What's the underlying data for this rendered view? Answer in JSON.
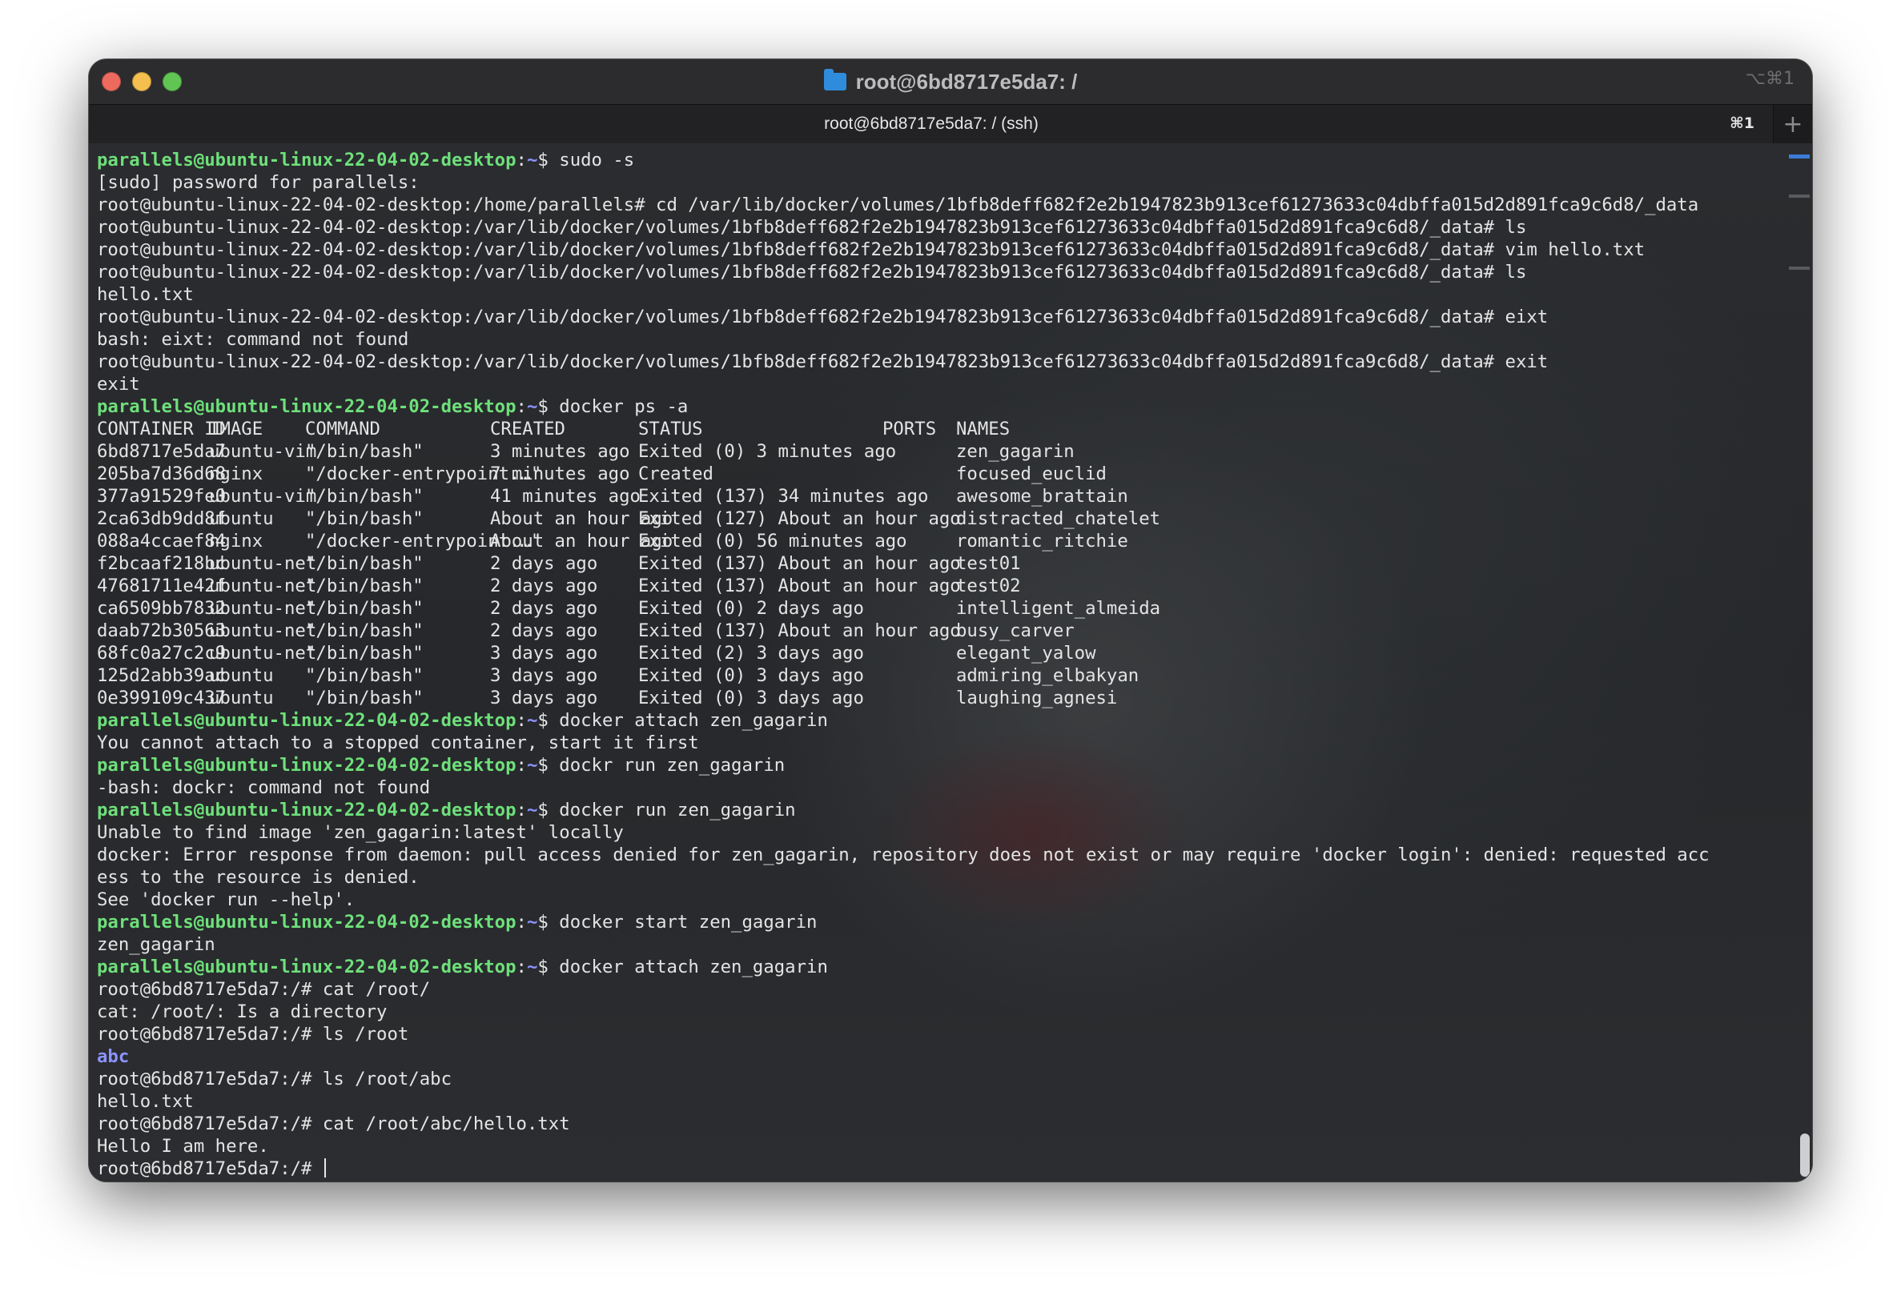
{
  "window": {
    "title": "root@6bd8717e5da7: /",
    "shortcut": "⌥⌘1",
    "tab_label": "root@6bd8717e5da7: / (ssh)",
    "tab_shortcut": "⌘1",
    "new_tab": "+"
  },
  "colors": {
    "prompt_green": "#6ee07a",
    "dir_blue": "#8d93ff",
    "text": "#e4e4e4",
    "close": "#ed6a5e",
    "minimize": "#f4bf4f",
    "zoom": "#61c554"
  },
  "terminal": {
    "prompt_user": "parallels@ubuntu-linux-22-04-02-desktop",
    "lines_a": [
      {
        "type": "prompt",
        "path": "~",
        "cmd": " sudo -s"
      },
      {
        "type": "text",
        "text": "[sudo] password for parallels:"
      },
      {
        "type": "text",
        "text": "root@ubuntu-linux-22-04-02-desktop:/home/parallels# cd /var/lib/docker/volumes/1bfb8deff682f2e2b1947823b913cef61273633c04dbffa015d2d891fca9c6d8/_data"
      },
      {
        "type": "text",
        "text": "root@ubuntu-linux-22-04-02-desktop:/var/lib/docker/volumes/1bfb8deff682f2e2b1947823b913cef61273633c04dbffa015d2d891fca9c6d8/_data# ls"
      },
      {
        "type": "text",
        "text": "root@ubuntu-linux-22-04-02-desktop:/var/lib/docker/volumes/1bfb8deff682f2e2b1947823b913cef61273633c04dbffa015d2d891fca9c6d8/_data# vim hello.txt"
      },
      {
        "type": "text",
        "text": "root@ubuntu-linux-22-04-02-desktop:/var/lib/docker/volumes/1bfb8deff682f2e2b1947823b913cef61273633c04dbffa015d2d891fca9c6d8/_data# ls"
      },
      {
        "type": "text",
        "text": "hello.txt"
      },
      {
        "type": "text",
        "text": "root@ubuntu-linux-22-04-02-desktop:/var/lib/docker/volumes/1bfb8deff682f2e2b1947823b913cef61273633c04dbffa015d2d891fca9c6d8/_data# eixt"
      },
      {
        "type": "text",
        "text": "bash: eixt: command not found"
      },
      {
        "type": "text",
        "text": "root@ubuntu-linux-22-04-02-desktop:/var/lib/docker/volumes/1bfb8deff682f2e2b1947823b913cef61273633c04dbffa015d2d891fca9c6d8/_data# exit"
      },
      {
        "type": "text",
        "text": "exit"
      },
      {
        "type": "prompt",
        "path": "~",
        "cmd": " docker ps -a"
      }
    ],
    "ps_table": {
      "headers": [
        "CONTAINER ID",
        "IMAGE",
        "COMMAND",
        "CREATED",
        "STATUS",
        "PORTS",
        "NAMES"
      ],
      "rows": [
        [
          "6bd8717e5da7",
          "ubuntu-vim",
          "\"/bin/bash\"",
          "3 minutes ago",
          "Exited (0) 3 minutes ago",
          "",
          "zen_gagarin"
        ],
        [
          "205ba7d36d68",
          "nginx",
          "\"/docker-entrypoint.…\"",
          "7 minutes ago",
          "Created",
          "",
          "focused_euclid"
        ],
        [
          "377a91529fe0",
          "ubuntu-vim",
          "\"/bin/bash\"",
          "41 minutes ago",
          "Exited (137) 34 minutes ago",
          "",
          "awesome_brattain"
        ],
        [
          "2ca63db9dd8f",
          "ubuntu",
          "\"/bin/bash\"",
          "About an hour ago",
          "Exited (127) About an hour ago",
          "",
          "distracted_chatelet"
        ],
        [
          "088a4ccaef84",
          "nginx",
          "\"/docker-entrypoint.…\"",
          "About an hour ago",
          "Exited (0) 56 minutes ago",
          "",
          "romantic_ritchie"
        ],
        [
          "f2bcaaf218bc",
          "ubuntu-net",
          "\"/bin/bash\"",
          "2 days ago",
          "Exited (137) About an hour ago",
          "",
          "test01"
        ],
        [
          "47681711e42f",
          "ubuntu-net",
          "\"/bin/bash\"",
          "2 days ago",
          "Exited (137) About an hour ago",
          "",
          "test02"
        ],
        [
          "ca6509bb7832",
          "ubuntu-net",
          "\"/bin/bash\"",
          "2 days ago",
          "Exited (0) 2 days ago",
          "",
          "intelligent_almeida"
        ],
        [
          "daab72b30563",
          "ubuntu-net",
          "\"/bin/bash\"",
          "2 days ago",
          "Exited (137) About an hour ago",
          "",
          "busy_carver"
        ],
        [
          "68fc0a27c2c9",
          "ubuntu-net",
          "\"/bin/bash\"",
          "3 days ago",
          "Exited (2) 3 days ago",
          "",
          "elegant_yalow"
        ],
        [
          "125d2abb39ac",
          "ubuntu",
          "\"/bin/bash\"",
          "3 days ago",
          "Exited (0) 3 days ago",
          "",
          "admiring_elbakyan"
        ],
        [
          "0e399109c437",
          "ubuntu",
          "\"/bin/bash\"",
          "3 days ago",
          "Exited (0) 3 days ago",
          "",
          "laughing_agnesi"
        ]
      ]
    },
    "lines_b": [
      {
        "type": "prompt",
        "path": "~",
        "cmd": " docker attach zen_gagarin"
      },
      {
        "type": "text",
        "text": "You cannot attach to a stopped container, start it first"
      },
      {
        "type": "prompt",
        "path": "~",
        "cmd": " dockr run zen_gagarin"
      },
      {
        "type": "text",
        "text": "-bash: dockr: command not found"
      },
      {
        "type": "prompt",
        "path": "~",
        "cmd": " docker run zen_gagarin"
      },
      {
        "type": "text",
        "text": "Unable to find image 'zen_gagarin:latest' locally"
      },
      {
        "type": "text",
        "text": "docker: Error response from daemon: pull access denied for zen_gagarin, repository does not exist or may require 'docker login': denied: requested acc"
      },
      {
        "type": "text",
        "text": "ess to the resource is denied."
      },
      {
        "type": "text",
        "text": "See 'docker run --help'."
      },
      {
        "type": "prompt",
        "path": "~",
        "cmd": " docker start zen_gagarin"
      },
      {
        "type": "text",
        "text": "zen_gagarin"
      },
      {
        "type": "prompt",
        "path": "~",
        "cmd": " docker attach zen_gagarin"
      },
      {
        "type": "text",
        "text": "root@6bd8717e5da7:/# cat /root/"
      },
      {
        "type": "text",
        "text": "cat: /root/: Is a directory"
      },
      {
        "type": "text",
        "text": "root@6bd8717e5da7:/# ls /root"
      },
      {
        "type": "dir",
        "text": "abc"
      },
      {
        "type": "text",
        "text": "root@6bd8717e5da7:/# ls /root/abc"
      },
      {
        "type": "text",
        "text": "hello.txt"
      },
      {
        "type": "text",
        "text": "root@6bd8717e5da7:/# cat /root/abc/hello.txt"
      },
      {
        "type": "text",
        "text": "Hello I am here."
      },
      {
        "type": "cursor",
        "text": "root@6bd8717e5da7:/# "
      }
    ]
  }
}
